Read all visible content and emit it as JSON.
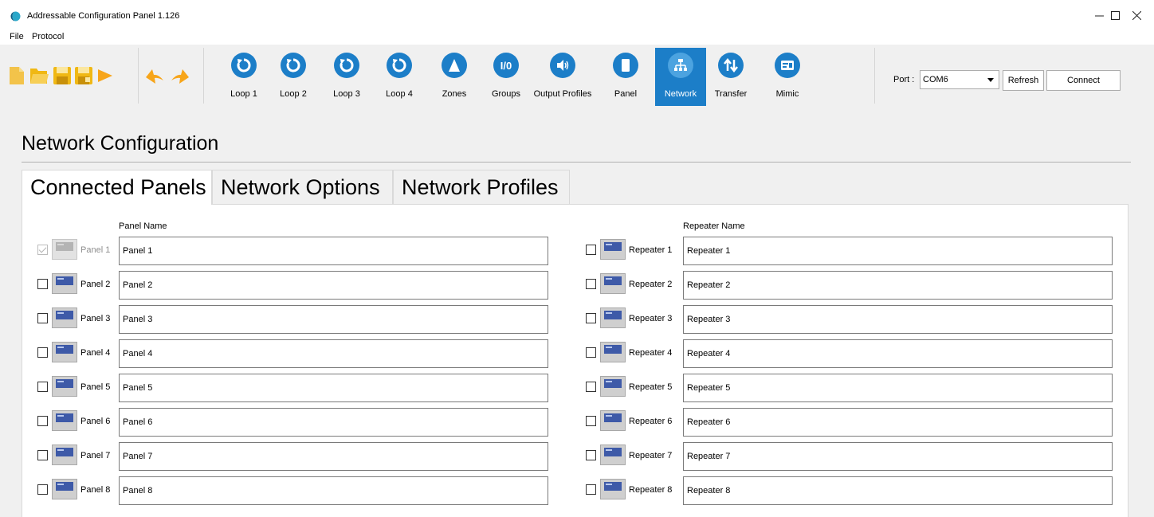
{
  "window": {
    "title": "Addressable Configuration Panel 1.126"
  },
  "menu": [
    "File",
    "Protocol"
  ],
  "toolbar": {
    "nav": [
      {
        "label": "Loop 1",
        "icon": "loop-icon"
      },
      {
        "label": "Loop 2",
        "icon": "loop-icon"
      },
      {
        "label": "Loop 3",
        "icon": "loop-icon"
      },
      {
        "label": "Loop 4",
        "icon": "loop-icon"
      },
      {
        "label": "Zones",
        "icon": "zones-icon"
      },
      {
        "label": "Groups",
        "icon": "groups-io-icon"
      },
      {
        "label": "Output Profiles",
        "icon": "speaker-icon"
      },
      {
        "label": "Panel",
        "icon": "panel-icon"
      },
      {
        "label": "Network",
        "icon": "network-icon",
        "active": true
      },
      {
        "label": "Transfer",
        "icon": "transfer-icon"
      },
      {
        "label": "Mimic",
        "icon": "mimic-icon"
      }
    ],
    "port_label": "Port :",
    "port_value": "COM6",
    "refresh_label": "Refresh",
    "connect_label": "Connect"
  },
  "page": {
    "title": "Network Configuration",
    "tabs": [
      "Connected Panels",
      "Network Options",
      "Network Profiles"
    ],
    "active_tab": "Connected Panels"
  },
  "panels": {
    "header": "Panel Name",
    "rows": [
      {
        "label": "Panel 1",
        "value": "Panel 1",
        "checked": true,
        "disabled": true
      },
      {
        "label": "Panel 2",
        "value": "Panel 2",
        "checked": false
      },
      {
        "label": "Panel 3",
        "value": "Panel 3",
        "checked": false
      },
      {
        "label": "Panel 4",
        "value": "Panel 4",
        "checked": false
      },
      {
        "label": "Panel 5",
        "value": "Panel 5",
        "checked": false
      },
      {
        "label": "Panel 6",
        "value": "Panel 6",
        "checked": false
      },
      {
        "label": "Panel 7",
        "value": "Panel 7",
        "checked": false
      },
      {
        "label": "Panel 8",
        "value": "Panel 8",
        "checked": false
      }
    ]
  },
  "repeaters": {
    "header": "Repeater Name",
    "rows": [
      {
        "label": "Repeater 1",
        "value": "Repeater 1",
        "checked": false
      },
      {
        "label": "Repeater 2",
        "value": "Repeater 2",
        "checked": false
      },
      {
        "label": "Repeater 3",
        "value": "Repeater 3",
        "checked": false
      },
      {
        "label": "Repeater 4",
        "value": "Repeater 4",
        "checked": false
      },
      {
        "label": "Repeater 5",
        "value": "Repeater 5",
        "checked": false
      },
      {
        "label": "Repeater 6",
        "value": "Repeater 6",
        "checked": false
      },
      {
        "label": "Repeater 7",
        "value": "Repeater 7",
        "checked": false
      },
      {
        "label": "Repeater 8",
        "value": "Repeater 8",
        "checked": false
      }
    ]
  },
  "colors": {
    "accent": "#1c7ec8",
    "file_icons": "#f3c34a",
    "save_icons": "#f0b814",
    "arrow_icons": "#f7a51a"
  }
}
